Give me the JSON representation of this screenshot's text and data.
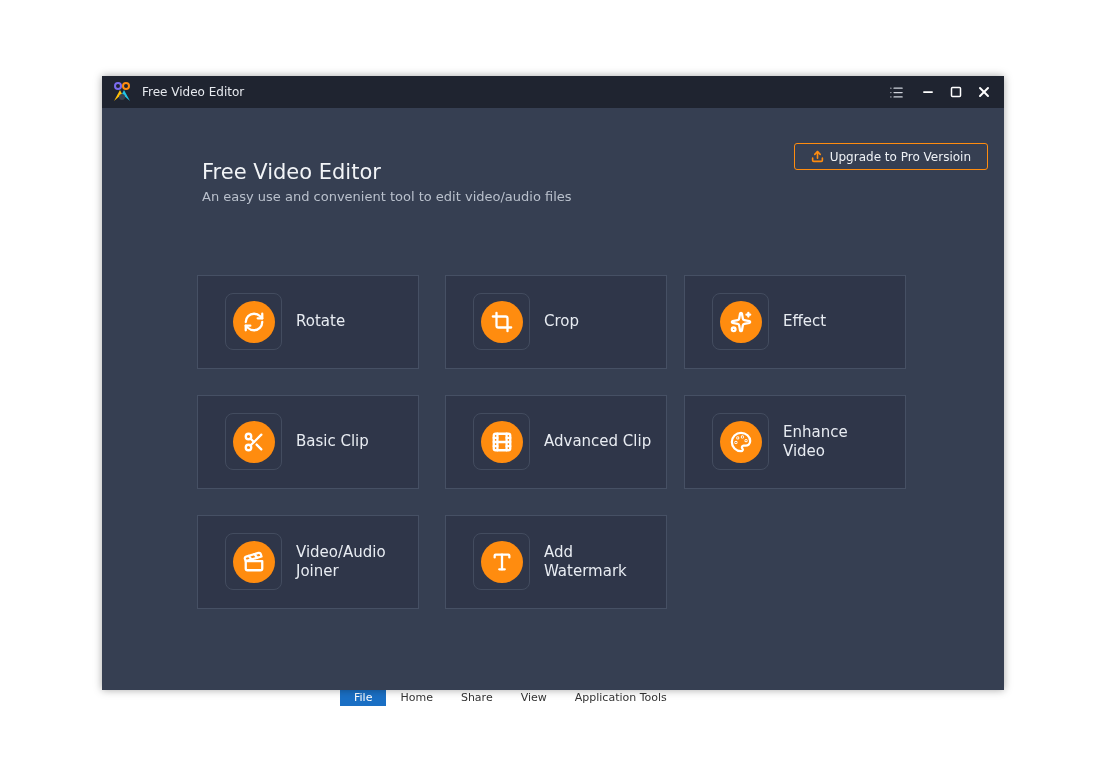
{
  "window": {
    "title": "Free Video Editor"
  },
  "header": {
    "title": "Free Video Editor",
    "subtitle": "An easy use and convenient tool to edit video/audio files"
  },
  "upgrade_button": {
    "label": "Upgrade to Pro Versioin"
  },
  "tools": [
    {
      "kind": "rotate",
      "label": "Rotate"
    },
    {
      "kind": "crop",
      "label": "Crop"
    },
    {
      "kind": "effect",
      "label": "Effect"
    },
    {
      "kind": "basic-clip",
      "label": "Basic Clip"
    },
    {
      "kind": "advanced-clip",
      "label": "Advanced Clip"
    },
    {
      "kind": "enhance",
      "label": "Enhance\nVideo"
    },
    {
      "kind": "joiner",
      "label": "Video/Audio\nJoiner"
    },
    {
      "kind": "watermark",
      "label": "Add\nWatermark"
    }
  ],
  "background_ribbon": {
    "tabs": [
      {
        "label": "File",
        "selected": true
      },
      {
        "label": "Home",
        "selected": false
      },
      {
        "label": "Share",
        "selected": false
      },
      {
        "label": "View",
        "selected": false
      },
      {
        "label": "Application Tools",
        "selected": false
      }
    ]
  }
}
